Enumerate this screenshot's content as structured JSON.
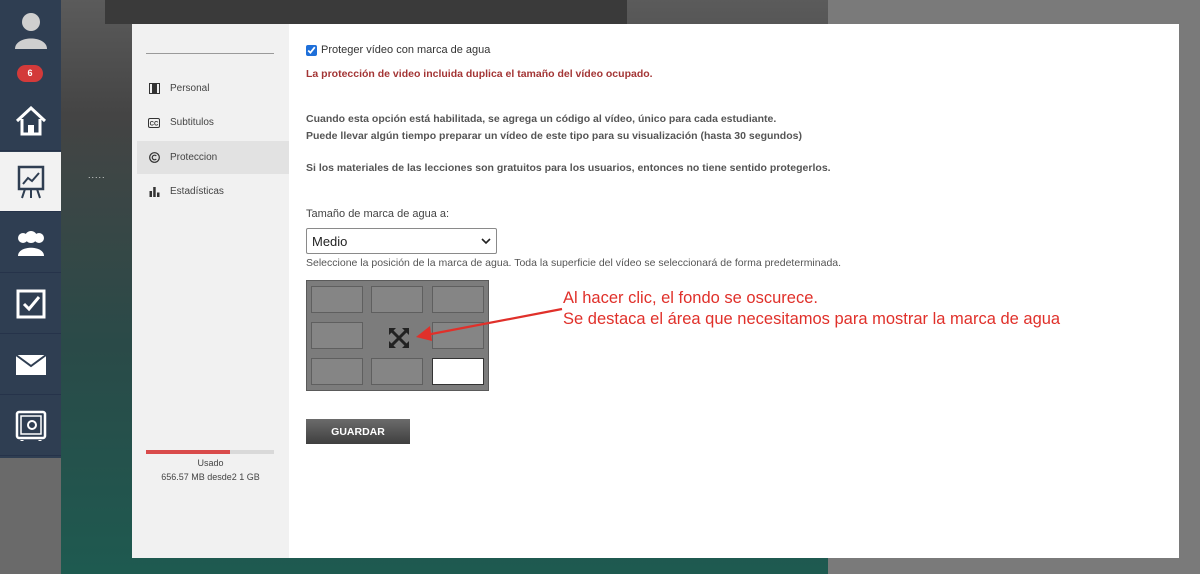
{
  "appbar": {
    "notification_count": "6",
    "icons": [
      "user-avatar-icon",
      "home-icon",
      "presentation-chart-icon",
      "users-icon",
      "checkbox-icon",
      "mail-icon",
      "safe-settings-icon"
    ]
  },
  "sidebar": {
    "items": [
      {
        "label": "Personal",
        "icon": "film-icon"
      },
      {
        "label": "Subtitulos",
        "icon": "cc-icon"
      },
      {
        "label": "Proteccion",
        "icon": "copyright-icon"
      },
      {
        "label": "Estadísticas",
        "icon": "bar-chart-icon"
      }
    ],
    "active_index": 2,
    "usage_label": "Usado",
    "usage_value": "656.57 MB desde2 1 GB",
    "usage_fraction": 0.66
  },
  "protection": {
    "checkbox_label": "Proteger vídeo con marca de agua",
    "checkbox_checked": true,
    "warning": "La protección de video incluida duplica el tamaño del vídeo ocupado.",
    "info_line1": "Cuando esta opción está habilitada, se agrega un código al vídeo, único para cada estudiante.",
    "info_line2": "Puede llevar algún tiempo preparar un vídeo de este tipo para su visualización (hasta 30 segundos)",
    "info_line3": "Si los materiales de las lecciones son gratuitos para los usuarios, entonces no tiene sentido protegerlos.",
    "size_label": "Tamaño de marca de agua a:",
    "size_value": "Medio",
    "position_label": "Seleccione la posición de la marca de agua. Toda la superficie del vídeo se seleccionará de forma predeterminada.",
    "selected_cell": "bottom-right",
    "save_label": "GUARDAR"
  },
  "annotation": {
    "line1": "Al hacer clic, el fondo se oscurece.",
    "line2": "Se destaca el área que necesitamos para mostrar la marca de agua",
    "color": "#e0302a"
  }
}
